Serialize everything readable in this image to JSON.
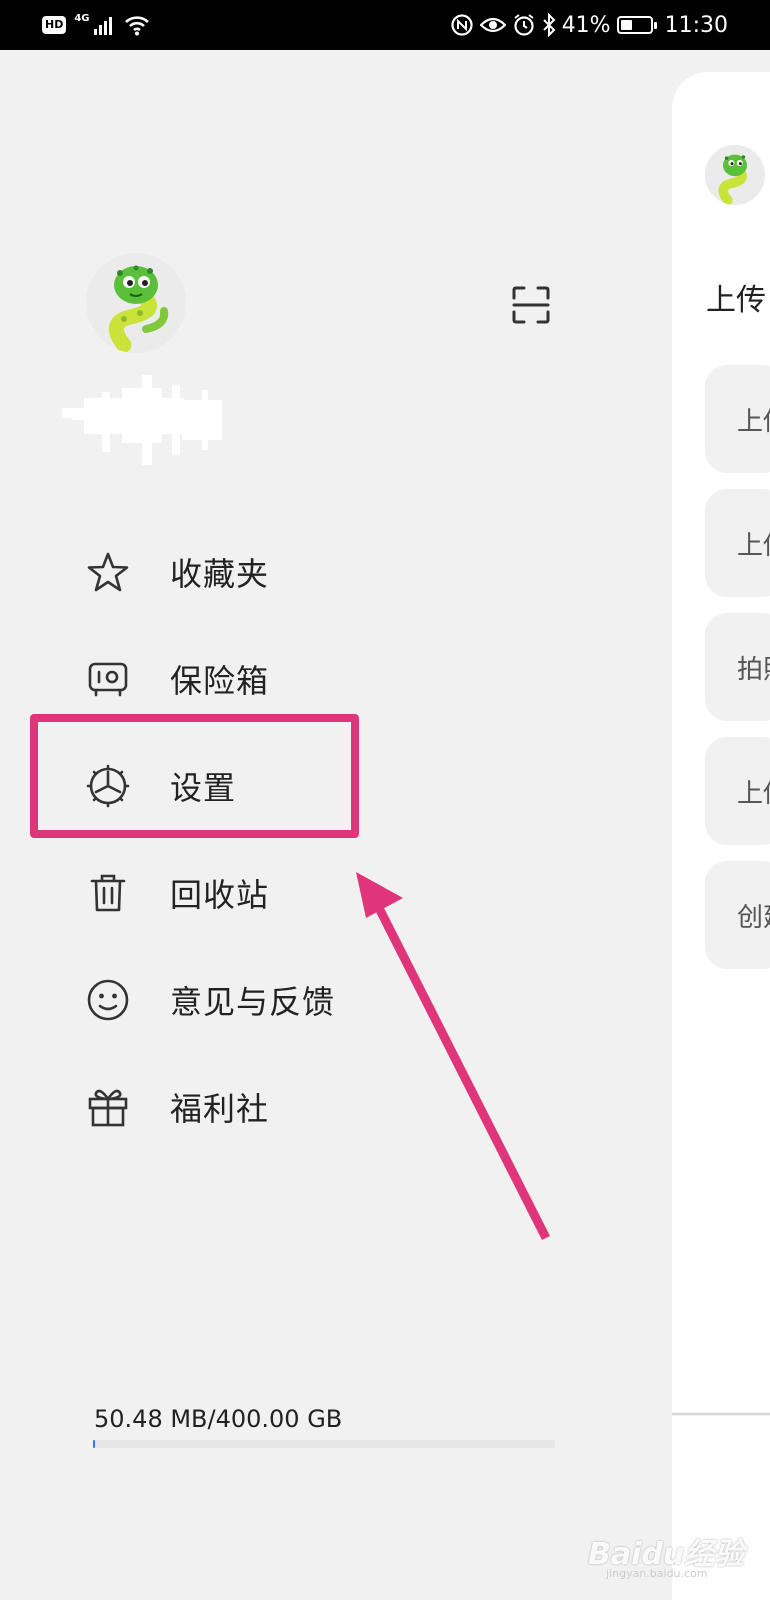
{
  "status_bar": {
    "hd": "HD",
    "network": "4G",
    "battery_percent": "41%",
    "battery_level": 0.41,
    "time": "11:30",
    "icons": [
      "signal-icon",
      "wifi-icon",
      "nfc-icon",
      "eye-comfort-icon",
      "alarm-icon",
      "bluetooth-icon",
      "battery-icon"
    ]
  },
  "drawer": {
    "menu": [
      {
        "label": "收藏夹",
        "icon": "star-icon"
      },
      {
        "label": "保险箱",
        "icon": "safe-icon"
      },
      {
        "label": "设置",
        "icon": "settings-icon"
      },
      {
        "label": "回收站",
        "icon": "trash-icon"
      },
      {
        "label": "意见与反馈",
        "icon": "smiley-icon"
      },
      {
        "label": "福利社",
        "icon": "gift-icon"
      }
    ],
    "storage": {
      "text": "50.48 MB/400.00 GB",
      "fraction": 0.0001
    }
  },
  "panel": {
    "title": "上传",
    "cards": [
      "上传",
      "上传",
      "拍照",
      "上传",
      "创建"
    ]
  },
  "annotation": {
    "highlighted_item": "设置",
    "color": "#e0357a"
  },
  "watermark": {
    "main": "Baidu经验",
    "sub": "jingyan.baidu.com"
  }
}
